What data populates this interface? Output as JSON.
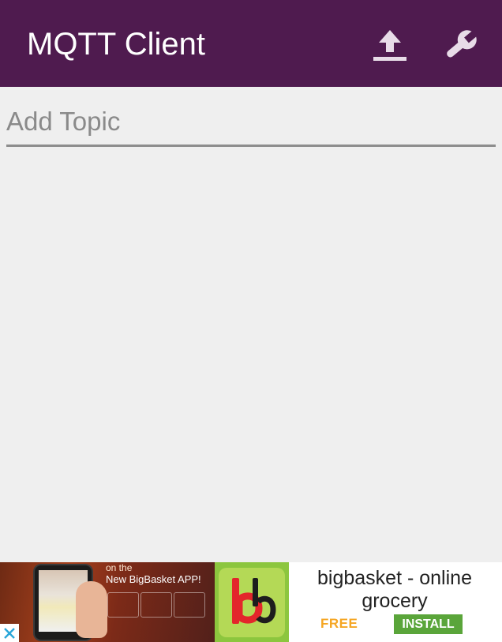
{
  "appbar": {
    "title": "MQTT Client",
    "background": "#4f1b4f",
    "actions": [
      {
        "icon": "upload-icon"
      },
      {
        "icon": "wrench-icon"
      }
    ]
  },
  "topic_input": {
    "placeholder": "Add Topic",
    "value": ""
  },
  "ad": {
    "image_caption_1": "on the",
    "image_caption_2": "New BigBasket APP!",
    "headline": "bigbasket - online grocery",
    "price_label": "FREE",
    "install_label": "INSTALL",
    "close_icon": "close-icon",
    "logo_icon": "bigbasket-logo-icon",
    "install_color": "#5aa53a",
    "free_color": "#f5a623",
    "logo_color": "#8cc63e"
  }
}
